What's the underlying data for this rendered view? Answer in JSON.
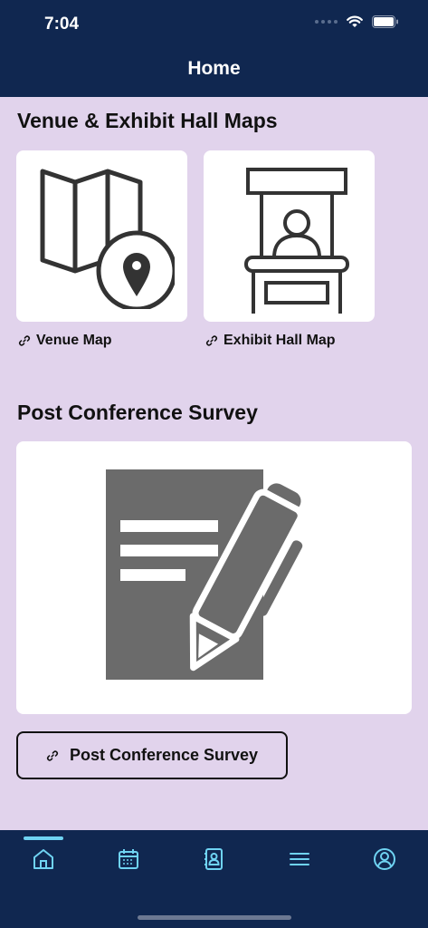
{
  "status_bar": {
    "time": "7:04"
  },
  "header": {
    "title": "Home"
  },
  "maps_section": {
    "title": "Venue & Exhibit Hall Maps",
    "cards": [
      {
        "label": "Venue Map",
        "icon": "map-pin-icon"
      },
      {
        "label": "Exhibit Hall Map",
        "icon": "exhibit-booth-icon"
      }
    ]
  },
  "survey_section": {
    "title": "Post Conference Survey",
    "icon": "document-pen-icon",
    "button_label": "Post Conference Survey"
  },
  "tabbar": {
    "tabs": [
      {
        "icon": "home-icon",
        "active": true
      },
      {
        "icon": "calendar-icon",
        "active": false
      },
      {
        "icon": "contacts-icon",
        "active": false
      },
      {
        "icon": "menu-icon",
        "active": false
      },
      {
        "icon": "profile-icon",
        "active": false
      }
    ]
  },
  "colors": {
    "header_bg": "#102750",
    "page_bg": "#e1d3ec",
    "tab_icon": "#6fd3f2"
  }
}
